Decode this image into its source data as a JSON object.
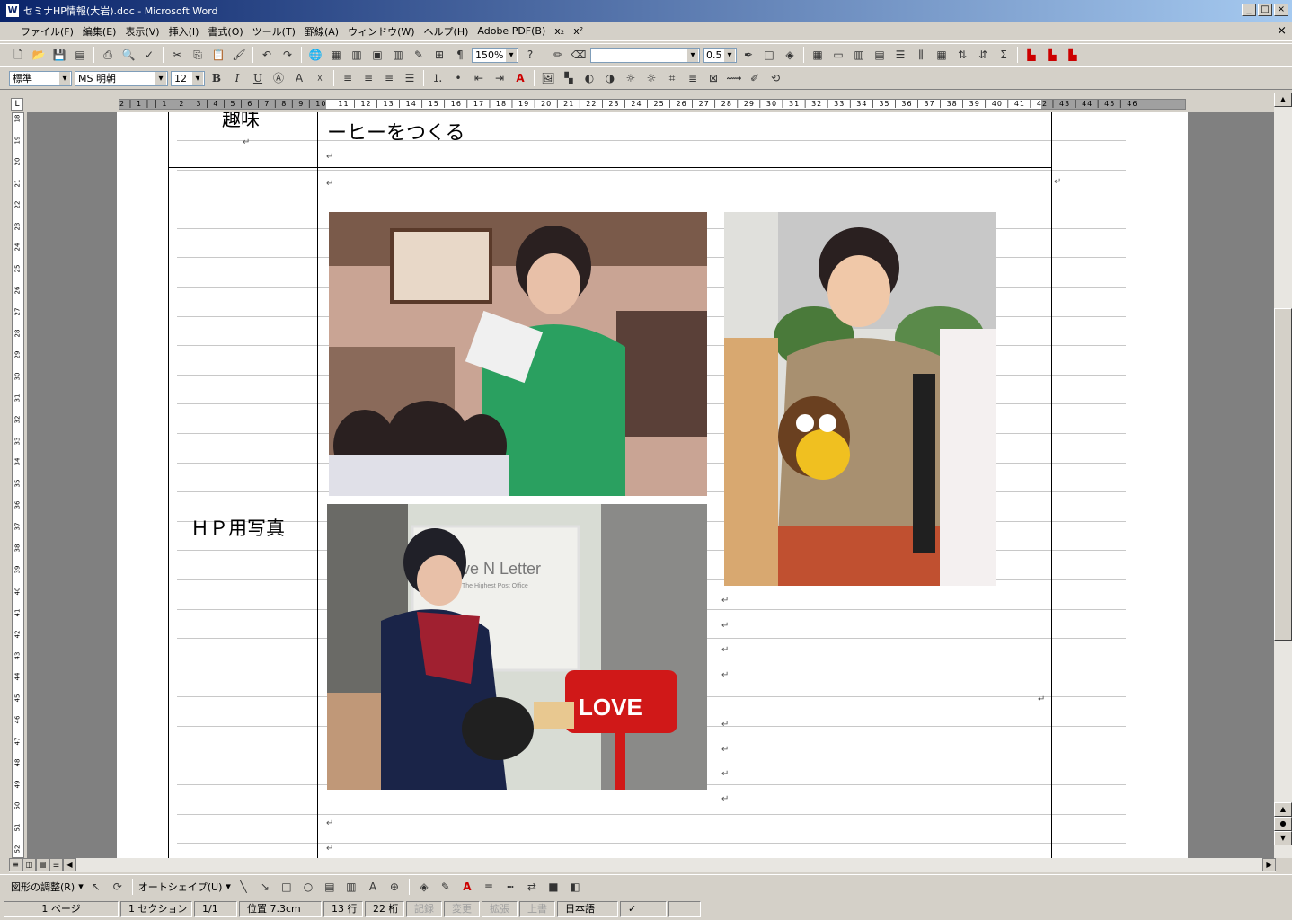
{
  "window": {
    "title": "セミナHP情報(大岩).doc - Microsoft Word",
    "app_icon": "W",
    "min": "_",
    "max": "□",
    "close": "×"
  },
  "menu": {
    "items": [
      "ファイル(F)",
      "編集(E)",
      "表示(V)",
      "挿入(I)",
      "書式(O)",
      "ツール(T)",
      "罫線(A)",
      "ウィンドウ(W)",
      "ヘルプ(H)",
      "Adobe PDF(B)",
      "x₂",
      "x²"
    ],
    "close_doc": "×"
  },
  "toolbar": {
    "zoom": "150%",
    "line_width": "0.5"
  },
  "format": {
    "style": "標準",
    "font": "MS 明朝",
    "size": "12",
    "bold": "B",
    "italic": "I",
    "underline": "U"
  },
  "ruler": {
    "h_ticks": "2 │ 1 │ │ 1 │ 2 │ 3 │ 4 │ 5 │ 6 │ 7 │ 8 │ 9 │ 10 │ 11 │ 12 │ 13 │ 14 │ 15 │ 16 │ 17 │ 18 │ 19 │ 20 │ 21 │ 22 │ 23 │ 24 │ 25 │ 26 │ 27 │ 28 │ 29 │ 30 │ 31 │ 32 │ 33 │ 34 │ 35 │ 36 │ 37 │ 38 │ 39 │ 40 │ 41 │ 42 │ 43 │ 44 │ 45 │ 46",
    "v_ticks": [
      "18",
      "19",
      "20",
      "21",
      "22",
      "23",
      "24",
      "25",
      "26",
      "27",
      "28",
      "29",
      "30",
      "31",
      "32",
      "33",
      "34",
      "35",
      "36",
      "37",
      "38",
      "39",
      "40",
      "41",
      "42",
      "43",
      "44",
      "45",
      "46",
      "47",
      "48",
      "49",
      "50",
      "51",
      "52"
    ]
  },
  "document": {
    "row1_label": "趣味",
    "row1_value": "ーヒーをつくる",
    "row2_label": "ＨＰ用写真",
    "para_mark": "↵",
    "photo3_sign_text": "ve N Letter",
    "photo3_sign_sub": "The Highest Post Office",
    "photo3_box_text": "LOVE"
  },
  "drawing": {
    "adjust": "図形の調整(R)",
    "autoshape": "オートシェイプ(U)"
  },
  "status": {
    "page": "1 ページ",
    "section": "1 セクション",
    "pages": "1/1",
    "position": "位置 7.3cm",
    "line": "13 行",
    "column": "22 桁",
    "rec": "記録",
    "trk": "変更",
    "ext": "拡張",
    "ovr": "上書",
    "lang": "日本語"
  }
}
